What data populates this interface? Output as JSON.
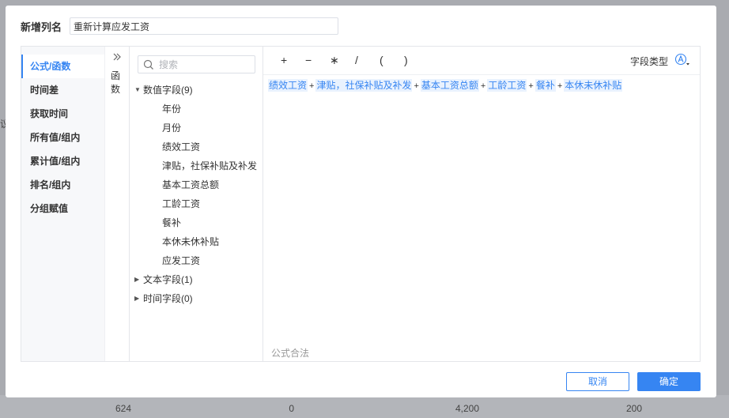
{
  "background": {
    "left_stub": "议",
    "cells": [
      "624",
      "0",
      "4,200",
      "200"
    ]
  },
  "dialog": {
    "title_label": "新增列名",
    "column_name_value": "重新计算应发工资"
  },
  "categories": [
    {
      "label": "公式/函数",
      "active": true
    },
    {
      "label": "时间差"
    },
    {
      "label": "获取时间"
    },
    {
      "label": "所有值/组内"
    },
    {
      "label": "累计值/组内"
    },
    {
      "label": "排名/组内"
    },
    {
      "label": "分组赋值"
    }
  ],
  "functions_panel": {
    "label": "函数",
    "expand_icon": "double-chevron-right-icon"
  },
  "search": {
    "placeholder": "搜索",
    "icon": "search-icon"
  },
  "tree": {
    "groups": [
      {
        "label": "数值字段(9)",
        "expanded": true,
        "children": [
          "年份",
          "月份",
          "绩效工资",
          "津贴，社保补贴及补发",
          "基本工资总额",
          "工龄工资",
          "餐补",
          "本休未休补贴",
          "应发工资"
        ]
      },
      {
        "label": "文本字段(1)",
        "expanded": false
      },
      {
        "label": "时间字段(0)",
        "expanded": false
      }
    ]
  },
  "toolbar": {
    "operators": [
      "+",
      "−",
      "∗",
      "/",
      "(",
      ")"
    ],
    "field_type_label": "字段类型",
    "field_type_icon": "circled-a-dropdown-icon"
  },
  "formula": {
    "tokens": [
      "绩效工资",
      "津贴，社保补贴及补发",
      "基本工资总额",
      "工龄工资",
      "餐补",
      "本休未休补贴"
    ],
    "operator": "+"
  },
  "status": "公式合法",
  "buttons": {
    "cancel": "取消",
    "ok": "确定"
  },
  "colors": {
    "accent": "#3685f2",
    "token_bg": "#e9f2fe",
    "sidebar_bg": "#f7f8fa"
  }
}
